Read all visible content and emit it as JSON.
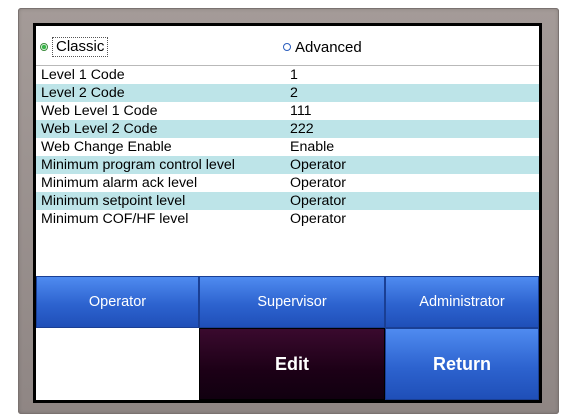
{
  "mode": {
    "options": [
      {
        "label": "Classic",
        "selected": true
      },
      {
        "label": "Advanced",
        "selected": false
      }
    ]
  },
  "security_codes": [
    {
      "label": "Level 1 Code",
      "value": "1"
    },
    {
      "label": "Level 2 Code",
      "value": "2"
    },
    {
      "label": "Web Level 1 Code",
      "value": "111"
    },
    {
      "label": "Web Level 2 Code",
      "value": "222"
    },
    {
      "label": "Web Change Enable",
      "value": "Enable"
    },
    {
      "label": "Minimum program control level",
      "value": "Operator"
    },
    {
      "label": "Minimum alarm ack level",
      "value": "Operator"
    },
    {
      "label": "Minimum setpoint level",
      "value": "Operator"
    },
    {
      "label": "Minimum COF/HF level",
      "value": "Operator"
    }
  ],
  "level_buttons": {
    "operator": "Operator",
    "supervisor": "Supervisor",
    "administrator": "Administrator"
  },
  "actions": {
    "edit": "Edit",
    "return": "Return"
  },
  "colors": {
    "row_alt": "#bde4e8",
    "button_blue": "#2d63cf",
    "button_dark": "#1c0016",
    "bezel": "#9a918f"
  }
}
